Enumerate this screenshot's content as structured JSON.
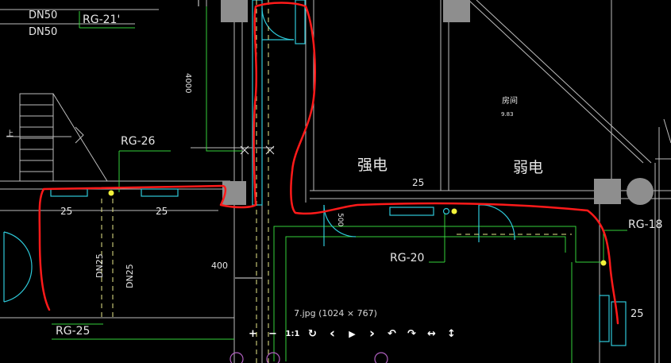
{
  "drawing": {
    "pipe_labels": {
      "dn50_a": "DN50",
      "dn50_b": "DN50",
      "rg21": "RG-21'",
      "rg26": "RG-26",
      "rg25": "RG-25",
      "rg20": "RG-20",
      "rg18": "RG-18",
      "dn25_a": "DN25",
      "dn25_b": "DN25"
    },
    "dimensions": {
      "d4000": "4000",
      "d25_top": "25",
      "d25_left_a": "25",
      "d25_left_b": "25",
      "d25_right": "25",
      "d500": "500",
      "d400": "400"
    },
    "room_labels": {
      "room": "房间",
      "room_num": "9.83",
      "strong_power": "强电",
      "weak_power": "弱电",
      "stair_up": "上"
    },
    "colors": {
      "background": "#000000",
      "wall": "#bdbdbd",
      "pipe_green": "#35d13a",
      "pipe_cyan": "#2ec8d8",
      "dashed_yellow": "#e8e88a",
      "markup_red": "#ff1a1a",
      "column_fill": "#8e8e8e"
    }
  },
  "viewer": {
    "caption": "7.jpg (1024 × 767)",
    "toolbar": [
      {
        "name": "zoom-in-button",
        "glyph": "+"
      },
      {
        "name": "zoom-out-button",
        "glyph": "−"
      },
      {
        "name": "actual-size-button",
        "glyph": "1:1"
      },
      {
        "name": "reset-button",
        "glyph": "↻"
      },
      {
        "name": "previous-button",
        "glyph": "‹"
      },
      {
        "name": "play-button",
        "glyph": "▶"
      },
      {
        "name": "next-button",
        "glyph": "›"
      },
      {
        "name": "rotate-left-button",
        "glyph": "↶"
      },
      {
        "name": "rotate-right-button",
        "glyph": "↷"
      },
      {
        "name": "flip-horizontal-button",
        "glyph": "↔"
      },
      {
        "name": "flip-vertical-button",
        "glyph": "↕"
      }
    ]
  }
}
